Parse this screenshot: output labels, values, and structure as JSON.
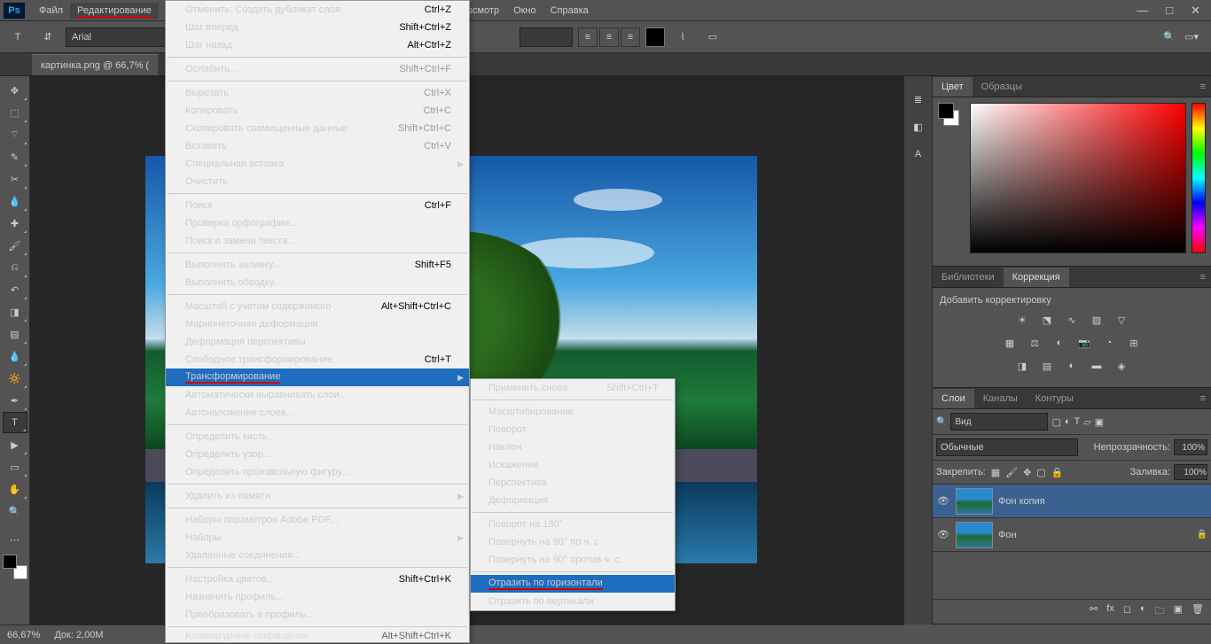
{
  "menubar": {
    "file": "Файл",
    "edit": "Редактирование",
    "view_partial": "осмотр",
    "window": "Окно",
    "help": "Справка"
  },
  "optbar": {
    "font": "Arial"
  },
  "tab": {
    "title": "картинка.png @ 66,7% ("
  },
  "panels": {
    "color": {
      "tab1": "Цвет",
      "tab2": "Образцы"
    },
    "lib": {
      "tab1": "Библиотеки",
      "tab2": "Коррекция"
    },
    "adj_title": "Добавить корректировку",
    "layers": {
      "tab1": "Слои",
      "tab2": "Каналы",
      "tab3": "Контуры",
      "kind": "Вид",
      "mode": "Обычные",
      "opacity_label": "Непрозрачность:",
      "opacity": "100%",
      "lock_label": "Закрепить:",
      "fill_label": "Заливка:",
      "fill": "100%",
      "layer1": "Фон копия",
      "layer2": "Фон"
    }
  },
  "search_placeholder": "",
  "edit_menu": [
    {
      "t": "row",
      "label": "Отменить: Создать дубликат слоя",
      "shortcut": "Ctrl+Z"
    },
    {
      "t": "row",
      "label": "Шаг вперед",
      "shortcut": "Shift+Ctrl+Z"
    },
    {
      "t": "row",
      "label": "Шаг назад",
      "shortcut": "Alt+Ctrl+Z"
    },
    {
      "t": "sep"
    },
    {
      "t": "row",
      "label": "Ослабить...",
      "shortcut": "Shift+Ctrl+F",
      "disabled": true
    },
    {
      "t": "sep"
    },
    {
      "t": "row",
      "label": "Вырезать",
      "shortcut": "Ctrl+X",
      "disabled": true
    },
    {
      "t": "row",
      "label": "Копировать",
      "shortcut": "Ctrl+C",
      "disabled": true
    },
    {
      "t": "row",
      "label": "Скопировать совмещенные данные",
      "shortcut": "Shift+Ctrl+C",
      "disabled": true
    },
    {
      "t": "row",
      "label": "Вставить",
      "shortcut": "Ctrl+V",
      "disabled": true
    },
    {
      "t": "row",
      "label": "Специальная вставка",
      "arrow": true,
      "disabled": true
    },
    {
      "t": "row",
      "label": "Очистить",
      "disabled": true
    },
    {
      "t": "sep"
    },
    {
      "t": "row",
      "label": "Поиск",
      "shortcut": "Ctrl+F"
    },
    {
      "t": "row",
      "label": "Проверка орфографии..."
    },
    {
      "t": "row",
      "label": "Поиск и замена текста..."
    },
    {
      "t": "sep"
    },
    {
      "t": "row",
      "label": "Выполнить заливку...",
      "shortcut": "Shift+F5"
    },
    {
      "t": "row",
      "label": "Выполнить обводку..."
    },
    {
      "t": "sep"
    },
    {
      "t": "row",
      "label": "Масштаб с учетом содержимого",
      "shortcut": "Alt+Shift+Ctrl+C"
    },
    {
      "t": "row",
      "label": "Марионеточная деформация"
    },
    {
      "t": "row",
      "label": "Деформация перспективы"
    },
    {
      "t": "row",
      "label": "Свободное трансформирование",
      "shortcut": "Ctrl+T"
    },
    {
      "t": "row",
      "label": "Трансформирование",
      "arrow": true,
      "highlighted": true,
      "underline": true
    },
    {
      "t": "row",
      "label": "Автоматически выравнивать слои...",
      "disabled": true
    },
    {
      "t": "row",
      "label": "Автоналожение слоев...",
      "disabled": true
    },
    {
      "t": "sep"
    },
    {
      "t": "row",
      "label": "Определить кисть..."
    },
    {
      "t": "row",
      "label": "Определить узор..."
    },
    {
      "t": "row",
      "label": "Определить произвольную фигуру...",
      "disabled": true
    },
    {
      "t": "sep"
    },
    {
      "t": "row",
      "label": "Удалить из памяти",
      "arrow": true
    },
    {
      "t": "sep"
    },
    {
      "t": "row",
      "label": "Наборы параметров Adobe PDF..."
    },
    {
      "t": "row",
      "label": "Наборы",
      "arrow": true
    },
    {
      "t": "row",
      "label": "Удаленные соединения..."
    },
    {
      "t": "sep"
    },
    {
      "t": "row",
      "label": "Настройка цветов...",
      "shortcut": "Shift+Ctrl+K"
    },
    {
      "t": "row",
      "label": "Назначить профиль..."
    },
    {
      "t": "row",
      "label": "Преобразовать в профиль..."
    },
    {
      "t": "sep"
    },
    {
      "t": "row",
      "label": "Клавиатурные сокращения...",
      "shortcut": "Alt+Shift+Ctrl+K",
      "cut": true
    }
  ],
  "sub_menu": [
    {
      "t": "row",
      "label": "Применить снова",
      "shortcut": "Shift+Ctrl+T",
      "disabled": true
    },
    {
      "t": "sep"
    },
    {
      "t": "row",
      "label": "Масштабирование"
    },
    {
      "t": "row",
      "label": "Поворот"
    },
    {
      "t": "row",
      "label": "Наклон"
    },
    {
      "t": "row",
      "label": "Искажение"
    },
    {
      "t": "row",
      "label": "Перспектива"
    },
    {
      "t": "row",
      "label": "Деформация"
    },
    {
      "t": "sep"
    },
    {
      "t": "row",
      "label": "Поворот на 180°"
    },
    {
      "t": "row",
      "label": "Повернуть на 90° по ч. с."
    },
    {
      "t": "row",
      "label": "Повернуть на 90° против ч. с."
    },
    {
      "t": "sep"
    },
    {
      "t": "row",
      "label": "Отразить по горизонтали",
      "highlighted": true,
      "underline": true
    },
    {
      "t": "row",
      "label": "Отразить по вертикали"
    }
  ],
  "status": {
    "zoom": "66,67%",
    "doc": "Док: 2,00M"
  }
}
